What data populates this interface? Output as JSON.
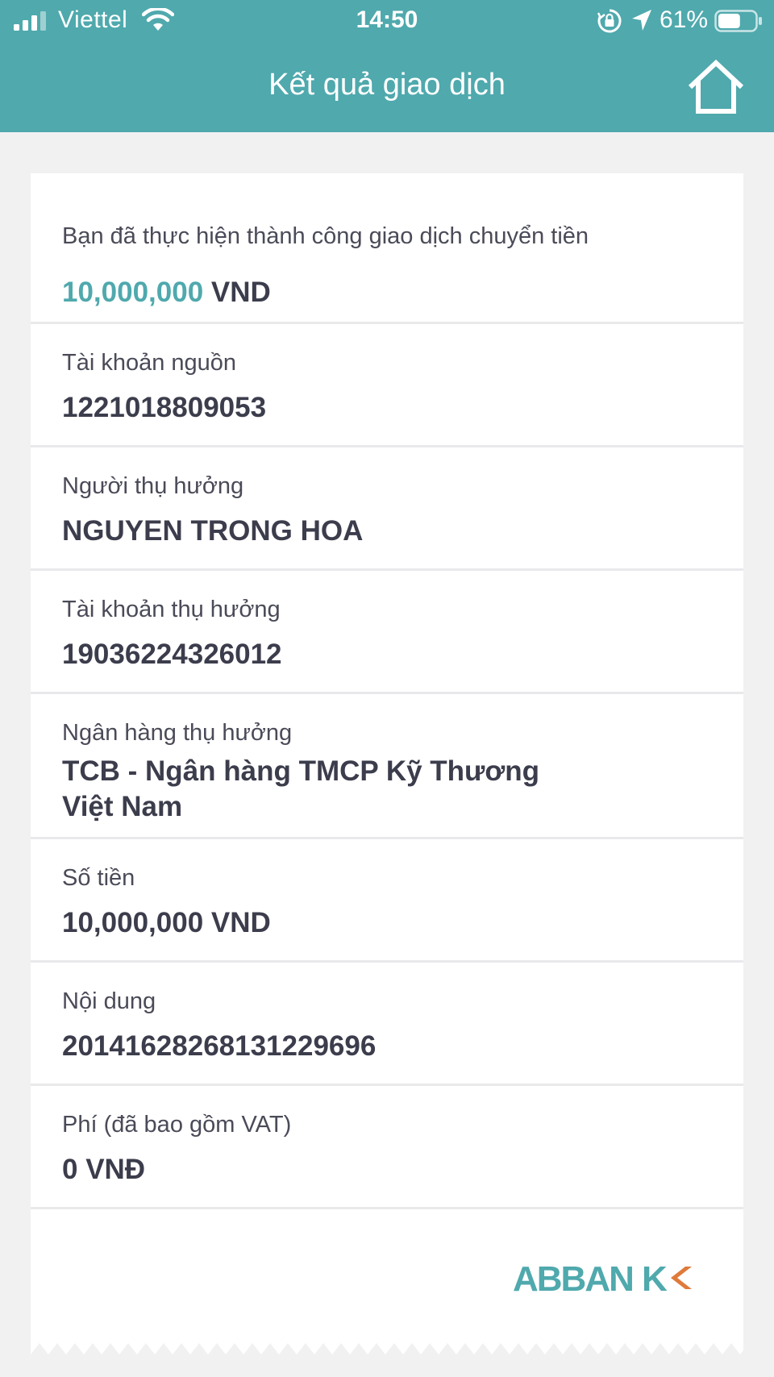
{
  "status_bar": {
    "carrier": "Viettel",
    "time": "14:50",
    "battery_percent": "61%",
    "battery_level": 0.61
  },
  "header": {
    "title": "Kết quả giao dịch",
    "home_icon": "home-icon"
  },
  "summary": {
    "message": "Bạn đã thực hiện thành công giao dịch chuyển tiền",
    "amount": "10,000,000",
    "currency": "VND"
  },
  "details": [
    {
      "label": "Tài khoản nguồn",
      "value": "1221018809053"
    },
    {
      "label": "Người thụ hưởng",
      "value": "NGUYEN TRONG HOA"
    },
    {
      "label": "Tài khoản thụ hưởng",
      "value": "19036224326012"
    },
    {
      "label": "Ngân hàng thụ hưởng",
      "value": "TCB - Ngân hàng TMCP Kỹ Thương",
      "value_line2": "Việt Nam"
    },
    {
      "label": "Số tiền",
      "value": "10,000,000 VND"
    },
    {
      "label": "Nội dung",
      "value": "20141628268131229696"
    },
    {
      "label": "Phí (đã bao gồm VAT)",
      "value": "0 VNĐ"
    }
  ],
  "brand": {
    "logo_text": "ABBANK",
    "primary_color": "#4fa9ad",
    "accent_color": "#e07a3a"
  }
}
